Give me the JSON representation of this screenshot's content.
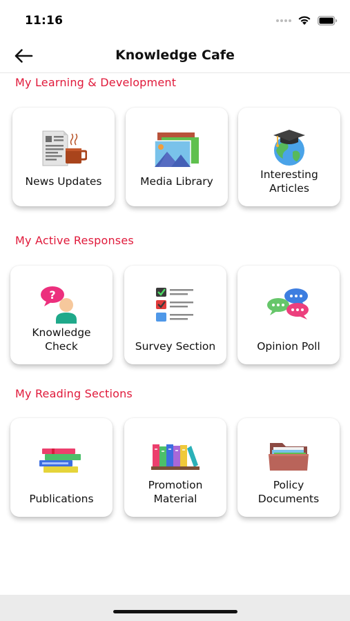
{
  "status": {
    "time": "11:16"
  },
  "header": {
    "title": "Knowledge Cafe",
    "back_icon": "arrow-left-icon"
  },
  "sections": [
    {
      "title": "My Learning & Development",
      "items": [
        {
          "label": "News Updates",
          "icon": "newspaper-coffee-icon"
        },
        {
          "label": "Media Library",
          "icon": "photo-gallery-icon"
        },
        {
          "label": "Interesting\nArticles",
          "icon": "globe-graduation-cap-icon"
        }
      ]
    },
    {
      "title": "My Active Responses",
      "items": [
        {
          "label": "Knowledge\nCheck",
          "icon": "person-question-icon"
        },
        {
          "label": "Survey Section",
          "icon": "checklist-icon"
        },
        {
          "label": "Opinion Poll",
          "icon": "chat-bubbles-icon"
        }
      ]
    },
    {
      "title": "My Reading Sections",
      "items": [
        {
          "label": "Publications",
          "icon": "book-stack-icon"
        },
        {
          "label": "Promotion\nMaterial",
          "icon": "bookshelf-icon"
        },
        {
          "label": "Policy\nDocuments",
          "icon": "folder-documents-icon"
        }
      ]
    }
  ],
  "colors": {
    "section_title": "#e0193a",
    "card_bg": "#ffffff",
    "home_bar_bg": "#ebebeb"
  }
}
